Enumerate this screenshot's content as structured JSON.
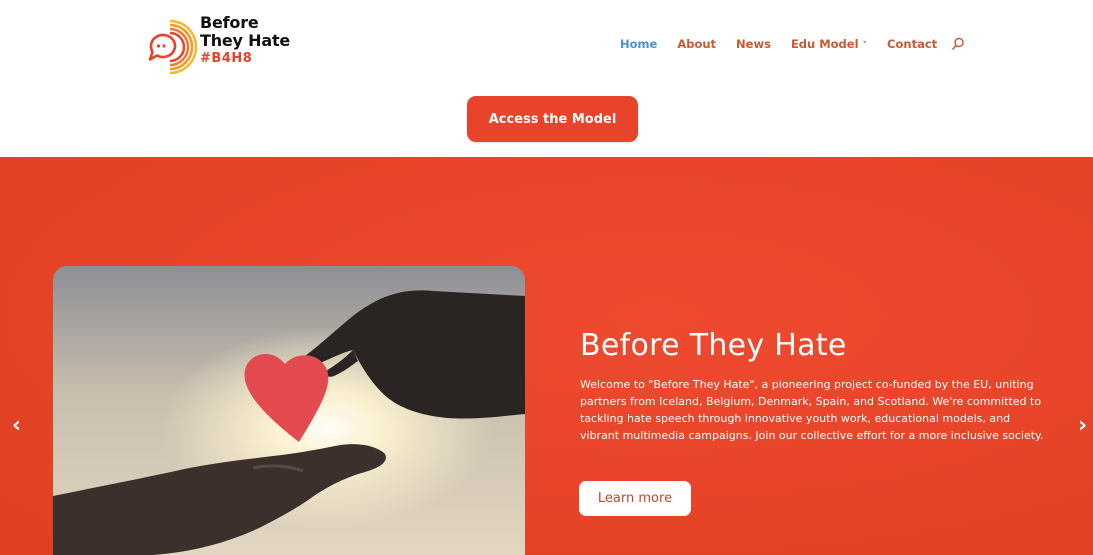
{
  "brand": {
    "line1": "Before",
    "line2": "They Hate",
    "tag": "#B4H8",
    "colors": {
      "accent": "#e8432b",
      "nav_active": "#4b93c8",
      "nav": "#c65a33"
    }
  },
  "nav": {
    "items": [
      {
        "label": "Home",
        "active": true
      },
      {
        "label": "About"
      },
      {
        "label": "News"
      },
      {
        "label": "Edu Model",
        "chevron": "˅"
      },
      {
        "label": "Contact"
      }
    ],
    "search_icon": "search-icon"
  },
  "cta": {
    "label": "Access the Model"
  },
  "hero": {
    "title": "Before They Hate",
    "text": "Welcome to \"Before They Hate\", a pioneering project co-funded by the EU, uniting partners from Iceland, Belgium, Denmark, Spain, and Scotland. We're committed to tackling hate speech through innovative youth work, educational models, and vibrant multimedia campaigns. Join our collective effort for a more inclusive society.",
    "button": "Learn more",
    "prev": "‹",
    "next": "›"
  }
}
